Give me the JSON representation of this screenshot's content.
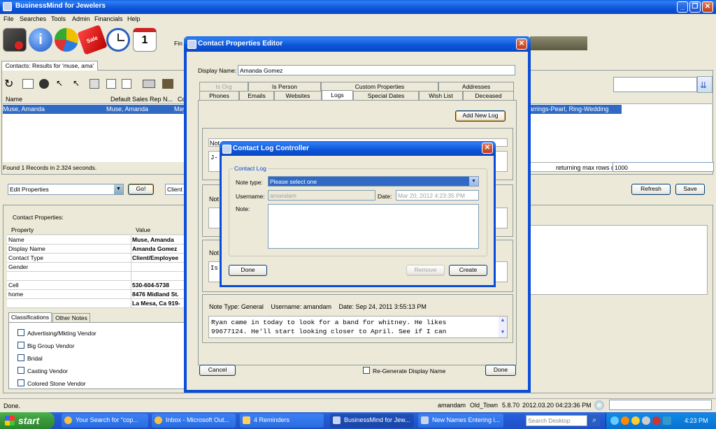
{
  "main": {
    "title": "BusinessMind for Jewelers",
    "menu": [
      "File",
      "Searches",
      "Tools",
      "Admin",
      "Financials",
      "Help"
    ],
    "find_label": "Fin",
    "results_tab": "Contacts: Results for 'muse, ama'",
    "table_headers": {
      "name": "Name",
      "rep": "Default Sales Rep N...",
      "col3": "Co"
    },
    "row": {
      "name": "Muse, Amanda",
      "rep": "Muse, Amanda",
      "col3": "May",
      "extra": "arrings-Pearl, Ring-Wedding"
    },
    "found_text": "Found 1 Records in 2.324 seconds.",
    "max_rows_label": "returning max rows of",
    "max_rows_value": "1000",
    "action_select": "Edit Properties",
    "go_button": "Go!",
    "client_label": "Client",
    "refresh_button": "Refresh",
    "save_button": "Save",
    "contact_properties_label": "Contact Properties:",
    "prop_headers": {
      "property": "Property",
      "value": "Value"
    },
    "props": [
      {
        "p": "Name",
        "v": "Muse, Amanda"
      },
      {
        "p": "Display Name",
        "v": "Amanda Gomez"
      },
      {
        "p": "Contact Type",
        "v": "Client/Employee"
      },
      {
        "p": "Gender",
        "v": ""
      },
      {
        "p": "",
        "v": ""
      },
      {
        "p": "Cell",
        "v": "530-604-5738"
      },
      {
        "p": "home",
        "v": "8476 Midland St."
      },
      {
        "p": "",
        "v": "La Mesa, Ca 919-"
      }
    ],
    "class_tabs": [
      "Classifications",
      "Other Notes"
    ],
    "classifications": [
      "Advertising/Mkting Vendor",
      "Big Group Vendor",
      "Bridal",
      "Casting Vendor",
      "Colored Stone Vendor"
    ],
    "status_left": "Done.",
    "status_user": "amandam",
    "status_store": "Old_Town",
    "status_version": "5.8.70",
    "status_time": "2012.03.20 04:23:36 PM"
  },
  "editor": {
    "title": "Contact Properties Editor",
    "display_name_label": "Display Name:",
    "display_name_value": "Amanda Gomez",
    "tabs_row1": [
      "Is Org",
      "Is Person",
      "Custom Properties",
      "Addresses"
    ],
    "tabs_row2": [
      "Phones",
      "Emails",
      "Websites",
      "Logs",
      "Special Dates",
      "Wish List",
      "Deceased"
    ],
    "add_log_button": "Add New Log",
    "log_frag_1": "Not",
    "log_frag_2": "J-",
    "log_frag_3": "Not",
    "log_frag_4": "Not",
    "log_frag_5": "Is",
    "log_entry": {
      "header_type": "Note Type: General",
      "header_user": "Username: amandam",
      "header_date": "Date: Sep 24, 2011 3:55:13 PM",
      "line1": "Ryan came in today to look for a band for whitney. He likes",
      "line2": "99677124. He'll start looking closer to April. See if I can"
    },
    "cancel_button": "Cancel",
    "regenerate_label": "Re-Generate Display Name",
    "done_button": "Done"
  },
  "log_controller": {
    "title": "Contact Log Controller",
    "group_label": "Contact Log",
    "note_type_label": "Note type:",
    "note_type_value": "Please select one",
    "username_label": "Username:",
    "username_value": "amandam",
    "date_label": "Date:",
    "date_value": "Mar 20, 2012 4:23:35 PM",
    "note_label": "Note:",
    "done_button": "Done",
    "remove_button": "Remove",
    "create_button": "Create"
  },
  "taskbar": {
    "start": "start",
    "items": [
      "Your Search for \"cop...",
      "Inbox - Microsoft Out...",
      "4 Reminders",
      "BusinessMind for Jew...",
      "New Names Entering i..."
    ],
    "search_placeholder": "Search Desktop",
    "clock": "4:23 PM"
  },
  "colors": {
    "selection": "#316ac5",
    "xp_blue": "#0a4ddb",
    "start_green": "#3c9a3c"
  }
}
